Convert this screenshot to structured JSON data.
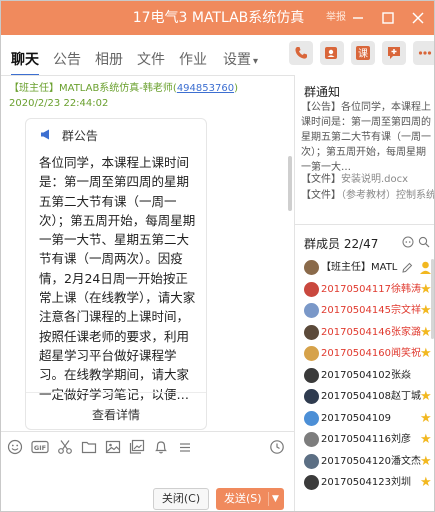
{
  "window": {
    "title": "17电气3 MATLAB系统仿真",
    "title_crest": "举报",
    "accent": "#f08a5d"
  },
  "tabs": [
    {
      "label": "聊天",
      "active": true
    },
    {
      "label": "公告"
    },
    {
      "label": "相册"
    },
    {
      "label": "文件"
    },
    {
      "label": "作业"
    },
    {
      "label": "设置"
    }
  ],
  "top_icons": [
    "phone-icon",
    "video-call-icon",
    "course-icon",
    "add-app-icon",
    "more-icon"
  ],
  "top_icon_glyphs": {
    "course": "课"
  },
  "message": {
    "sender": "【班主任】MATLAB系统仿真-韩老师(",
    "qq": "494853760",
    "time": ") 2020/2/23 22:44:02"
  },
  "announcement": {
    "header": "群公告",
    "body": "各位同学，本课程上课时间是：第一周至第四周的星期五第二大节有课（一周一次）；第五周开始，每周星期一第一大节、星期五第二大节有课（一周两次）。因疫情，2月24日周一开始按正常上课（在线教学），请大家注意各门课程的上课时间，按照任课老师的要求，利用超星学习平台做好课程学习。在线教学期间，请大家一定做好学习笔记，以便…",
    "detail_label": "查看详情"
  },
  "toolbar_icons": [
    "emoji-icon",
    "gif-icon",
    "scissors-icon",
    "folder-icon",
    "image-icon",
    "gallery-icon",
    "bell-icon",
    "more-tools-icon",
    "history-icon"
  ],
  "toolbar_glyphs": {
    "gif": "GIF"
  },
  "compose": {
    "close_label": "关闭(C)",
    "send_label": "发送(S)"
  },
  "notice": {
    "title": "群通知",
    "text": "【公告】各位同学，本课程上课时间是：第一周至第四周的星期五第二大节有课（一周一次）；第五周开始，每周星期一第一大…",
    "files": [
      {
        "label": "【文件】",
        "name": "安装说明.docx"
      },
      {
        "label": "【文件】",
        "name": "（参考教材）控制系统…"
      }
    ]
  },
  "members": {
    "title": "群成员 22/47",
    "list": [
      {
        "name": "【班主任】MATL",
        "red": false,
        "star": false,
        "owner": true,
        "avatar": "#8a6a4a"
      },
      {
        "name": "20170504117徐韩涛",
        "red": true,
        "star": true,
        "avatar": "#c9483e"
      },
      {
        "name": "20170504145宗文祥",
        "red": true,
        "star": true,
        "avatar": "#7a98c8"
      },
      {
        "name": "20170504146张家潞",
        "red": true,
        "star": true,
        "avatar": "#5b4a3a"
      },
      {
        "name": "20170504160闻笑祝",
        "red": true,
        "star": true,
        "avatar": "#d6a24a"
      },
      {
        "name": "20170504102张焱",
        "red": false,
        "star": false,
        "avatar": "#3a3a3a"
      },
      {
        "name": "20170504108赵丁城",
        "red": false,
        "star": true,
        "avatar": "#2f3b4f"
      },
      {
        "name": "20170504109",
        "red": false,
        "star": true,
        "avatar": "#4c8fd6"
      },
      {
        "name": "20170504116刘彦",
        "red": false,
        "star": true,
        "avatar": "#7d7d7d"
      },
      {
        "name": "20170504120潘文杰",
        "red": false,
        "star": true,
        "avatar": "#5c6f84"
      },
      {
        "name": "20170504123刘圳",
        "red": false,
        "star": true,
        "avatar": "#3b3b3b"
      }
    ]
  }
}
